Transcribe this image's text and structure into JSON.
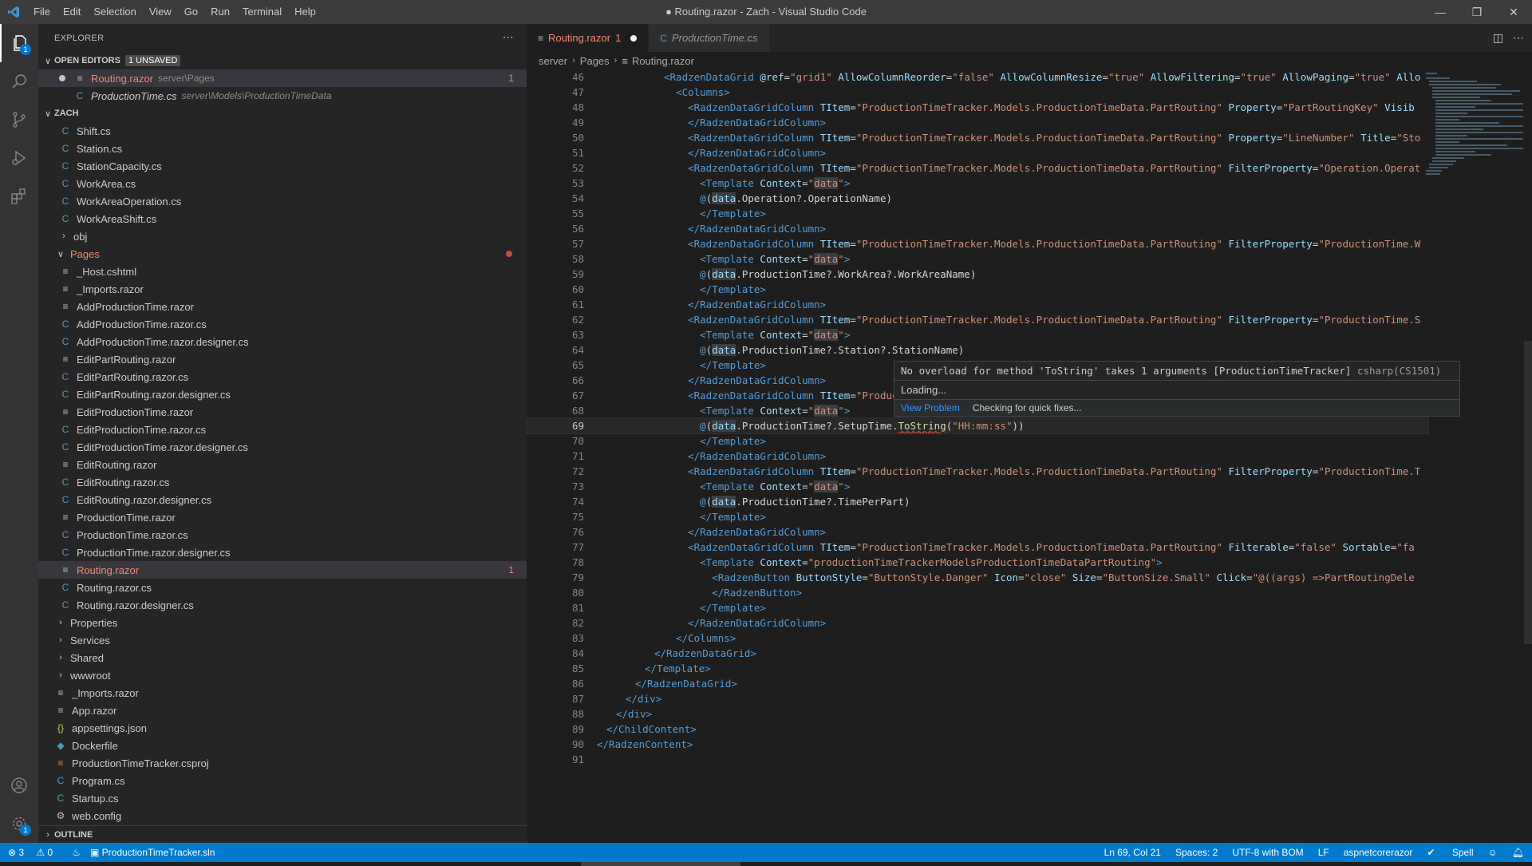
{
  "titlebar": {
    "menu": [
      "File",
      "Edit",
      "Selection",
      "View",
      "Go",
      "Run",
      "Terminal",
      "Help"
    ],
    "title": "● Routing.razor - Zach - Visual Studio Code"
  },
  "activity": {
    "explorer_badge": "1",
    "settings_badge": "1"
  },
  "explorer": {
    "header": "EXPLORER",
    "open_editors_label": "OPEN EDITORS",
    "unsaved_badge": "1 UNSAVED",
    "open_editors": [
      {
        "name": "Routing.razor",
        "path": "server\\Pages",
        "count": "1"
      },
      {
        "name": "ProductionTime.cs",
        "path": "server\\Models\\ProductionTimeData"
      }
    ],
    "workspace_label": "ZACH",
    "files": [
      {
        "name": "Shift.cs"
      },
      {
        "name": "Station.cs"
      },
      {
        "name": "StationCapacity.cs"
      },
      {
        "name": "WorkArea.cs"
      },
      {
        "name": "WorkAreaOperation.cs"
      },
      {
        "name": "WorkAreaShift.cs"
      }
    ],
    "obj": "obj",
    "pages": "Pages",
    "page_files": [
      {
        "name": "_Host.cshtml"
      },
      {
        "name": "_Imports.razor"
      },
      {
        "name": "AddProductionTime.razor"
      },
      {
        "name": "AddProductionTime.razor.cs"
      },
      {
        "name": "AddProductionTime.razor.designer.cs"
      },
      {
        "name": "EditPartRouting.razor"
      },
      {
        "name": "EditPartRouting.razor.cs"
      },
      {
        "name": "EditPartRouting.razor.designer.cs"
      },
      {
        "name": "EditProductionTime.razor"
      },
      {
        "name": "EditProductionTime.razor.cs"
      },
      {
        "name": "EditProductionTime.razor.designer.cs"
      },
      {
        "name": "EditRouting.razor"
      },
      {
        "name": "EditRouting.razor.cs"
      },
      {
        "name": "EditRouting.razor.designer.cs"
      },
      {
        "name": "ProductionTime.razor"
      },
      {
        "name": "ProductionTime.razor.cs"
      },
      {
        "name": "ProductionTime.razor.designer.cs"
      },
      {
        "name": "Routing.razor",
        "count": "1"
      },
      {
        "name": "Routing.razor.cs"
      },
      {
        "name": "Routing.razor.designer.cs"
      }
    ],
    "folders": [
      "Properties",
      "Services",
      "Shared",
      "wwwroot"
    ],
    "root_files": [
      {
        "name": "_Imports.razor"
      },
      {
        "name": "App.razor"
      },
      {
        "name": "appsettings.json"
      },
      {
        "name": "Dockerfile"
      },
      {
        "name": "ProductionTimeTracker.csproj"
      },
      {
        "name": "Program.cs"
      },
      {
        "name": "Startup.cs"
      },
      {
        "name": "web.config"
      }
    ],
    "outline_label": "OUTLINE"
  },
  "tabs": [
    {
      "label": "Routing.razor",
      "count": "1"
    },
    {
      "label": "ProductionTime.cs"
    }
  ],
  "breadcrumb": [
    "server",
    "Pages",
    "Routing.razor"
  ],
  "code_lines": [
    "46",
    "47",
    "48",
    "49",
    "50",
    "51",
    "52",
    "53",
    "54",
    "55",
    "56",
    "57",
    "58",
    "59",
    "60",
    "61",
    "62",
    "63",
    "64",
    "65",
    "66",
    "67",
    "68",
    "69",
    "70",
    "71",
    "72",
    "73",
    "74",
    "75",
    "76",
    "77",
    "78",
    "79",
    "80",
    "81",
    "82",
    "83",
    "84",
    "85",
    "86",
    "87",
    "88",
    "89",
    "90",
    "91"
  ],
  "hover": {
    "message": "No overload for method 'ToString' takes 1 arguments [ProductionTimeTracker]",
    "source": "csharp(CS1501)",
    "loading": "Loading...",
    "view_problem": "View Problem",
    "checking": "Checking for quick fixes..."
  },
  "status": {
    "errors": "3",
    "warnings": "0",
    "solution": "ProductionTimeTracker.sln",
    "position": "Ln 69, Col 21",
    "spaces": "Spaces: 2",
    "encoding": "UTF-8 with BOM",
    "eol": "LF",
    "language": "aspnetcorerazor",
    "spell": "Spell"
  }
}
